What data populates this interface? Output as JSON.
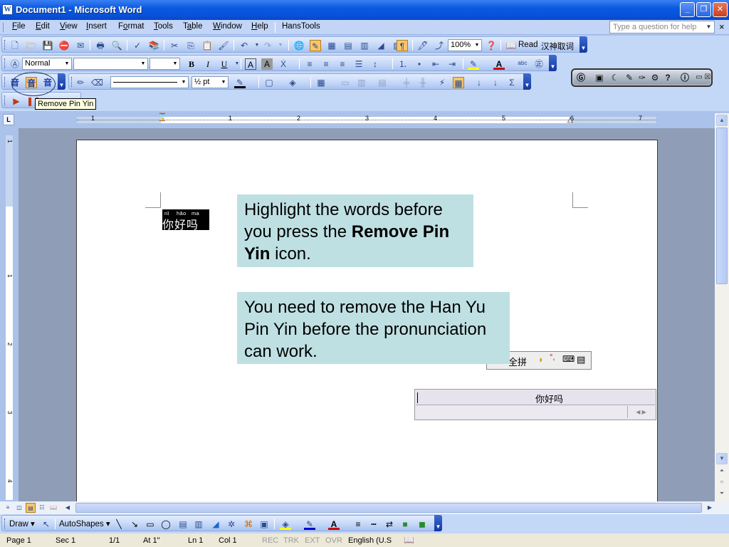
{
  "window": {
    "title": "Document1 - Microsoft Word",
    "app_icon": "W"
  },
  "menu": {
    "items": [
      {
        "label": "File",
        "accel": "F"
      },
      {
        "label": "Edit",
        "accel": "E"
      },
      {
        "label": "View",
        "accel": "V"
      },
      {
        "label": "Insert",
        "accel": "I"
      },
      {
        "label": "Format",
        "accel": "o"
      },
      {
        "label": "Tools",
        "accel": "T"
      },
      {
        "label": "Table",
        "accel": "a"
      },
      {
        "label": "Window",
        "accel": "W"
      },
      {
        "label": "Help",
        "accel": "H"
      },
      {
        "label": "HansTools",
        "accel": ""
      }
    ],
    "help_placeholder": "Type a question for help",
    "close_glyph": "×"
  },
  "standard_toolbar": {
    "zoom": "100%",
    "read_label": "Read",
    "chinese_label": "汉神取词"
  },
  "formatting_toolbar": {
    "style": "Normal",
    "font": "",
    "size": ""
  },
  "drawing_toolbar2": {
    "line_weight": "½ pt"
  },
  "tooltip": "Remove Pin Yin",
  "ruler": {
    "numbers": [
      "1",
      "1",
      "2",
      "3",
      "4",
      "5",
      "6",
      "7"
    ],
    "tab_selector": "L"
  },
  "vruler": {
    "numbers": [
      "1",
      "1",
      "2",
      "3",
      "4"
    ]
  },
  "document": {
    "pinyin": [
      "nǐ",
      "hǎo",
      "ma"
    ],
    "hanzi": "你好吗",
    "callout1": {
      "pre": "Highlight the words before you press the ",
      "bold": "Remove Pin Yin",
      "post": " icon."
    },
    "callout2": "You need to remove the Han Yu Pin Yin before the pronunciation can work."
  },
  "ime": {
    "mode_label": "全拼",
    "candidate_text": "你好吗"
  },
  "drawbar": {
    "draw_label": "Draw",
    "autoshapes_label": "AutoShapes"
  },
  "status": {
    "page": "Page 1",
    "sec": "Sec 1",
    "pages": "1/1",
    "at": "At 1\"",
    "ln": "Ln 1",
    "col": "Col 1",
    "rec": "REC",
    "trk": "TRK",
    "ext": "EXT",
    "ovr": "OVR",
    "language": "English (U.S"
  }
}
